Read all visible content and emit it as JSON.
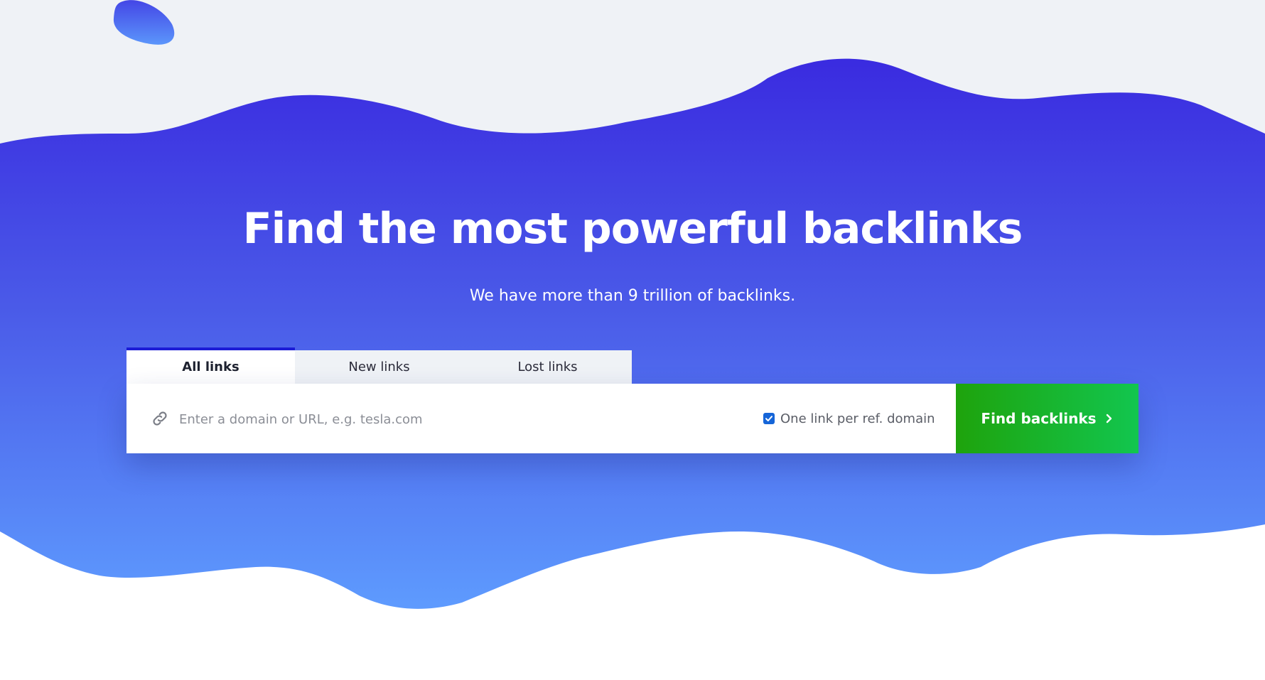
{
  "hero": {
    "title": "Find the most powerful backlinks",
    "subtitle": "We have more than 9 trillion of backlinks."
  },
  "tabs": [
    {
      "label": "All links",
      "active": true
    },
    {
      "label": "New links",
      "active": false
    },
    {
      "label": "Lost links",
      "active": false
    }
  ],
  "search": {
    "icon": "link-icon",
    "value": "",
    "placeholder": "Enter a domain or URL, e.g. tesla.com",
    "one_link_per_domain": {
      "label": "One link per ref. domain",
      "checked": true
    },
    "submit_label": "Find backlinks",
    "submit_icon": "chevron-right-icon"
  },
  "colors": {
    "gradient_top": "#3d2fe0",
    "gradient_bottom": "#5d99fd",
    "top_background": "#eff2f6",
    "active_tab_border": "#1c1cd6",
    "button_start": "#1ea30c",
    "button_end": "#12c64f",
    "checkbox": "#1565d8"
  }
}
